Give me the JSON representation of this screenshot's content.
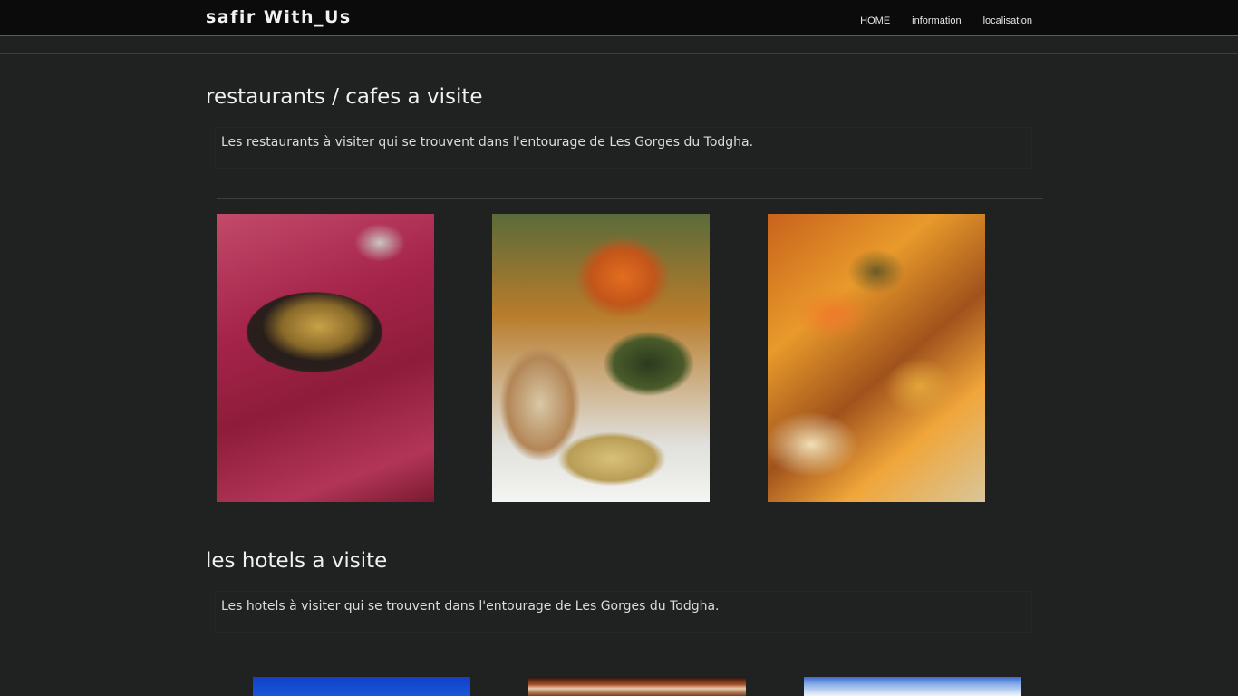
{
  "navbar": {
    "brand": "safir With_Us",
    "links": [
      "HOME",
      "information",
      "localisation"
    ]
  },
  "sections": [
    {
      "title": "restaurants / cafes a visite",
      "description": "Les restaurants à visiter qui se trouvent dans l'entourage de Les Gorges du Todgha."
    },
    {
      "title": "les hotels a visite",
      "description": "Les hotels à visiter qui se trouvent dans l'entourage de Les Gorges du Todgha."
    }
  ]
}
